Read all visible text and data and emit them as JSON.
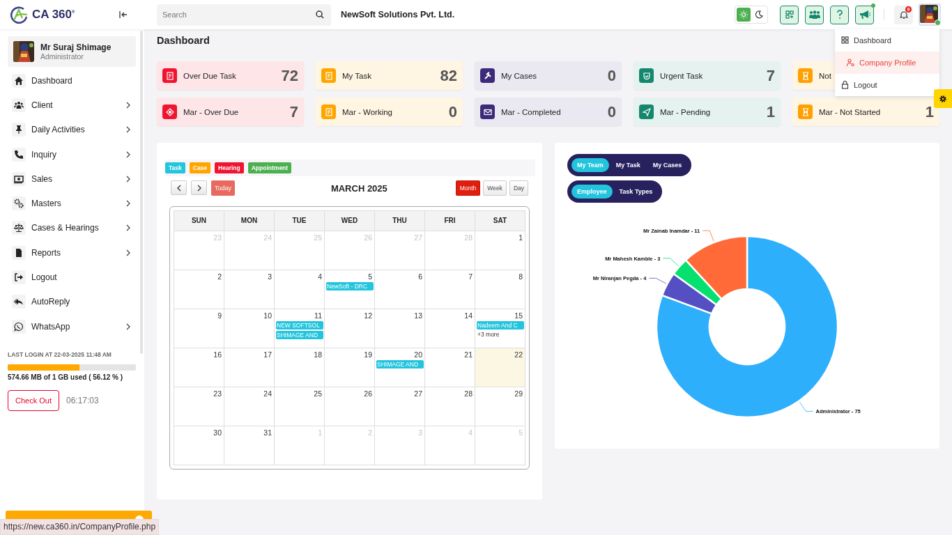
{
  "header": {
    "logo_text": "CA 360$^{®}$",
    "search": {
      "placeholder": "Search"
    },
    "company": "NewSoft Solutions Pvt. Ltd.",
    "theme": [
      {
        "kind": "sun",
        "selected": true
      },
      {
        "kind": "moon",
        "selected": false
      }
    ],
    "tools": [
      {
        "kind": "grid-plus",
        "dot": false
      },
      {
        "kind": "team",
        "dot": false
      },
      {
        "kind": "help",
        "dot": false
      },
      {
        "kind": "megaphone",
        "dot": true
      }
    ],
    "notifications": "9"
  },
  "user_menu": {
    "items": [
      {
        "kind": "grid",
        "label": "Dashboard",
        "selected": false
      },
      {
        "kind": "user-gear",
        "label": "Company Profile",
        "selected": true
      },
      {
        "kind": "lock",
        "label": "Logout",
        "selected": false
      }
    ]
  },
  "sidebar": {
    "profile": {
      "name": "Mr Suraj Shimage",
      "role": "Administrator"
    },
    "items": [
      {
        "kind": "home",
        "label": "Dashboard",
        "expandable": false
      },
      {
        "kind": "users",
        "label": "Client",
        "expandable": true
      },
      {
        "kind": "pin",
        "label": "Daily Activities",
        "expandable": true
      },
      {
        "kind": "phone",
        "label": "Inquiry",
        "expandable": true
      },
      {
        "kind": "money",
        "label": "Sales",
        "expandable": true
      },
      {
        "kind": "gears",
        "label": "Masters",
        "expandable": true
      },
      {
        "kind": "scales",
        "label": "Cases & Hearings",
        "expandable": true
      },
      {
        "kind": "file",
        "label": "Reports",
        "expandable": true
      },
      {
        "kind": "exit",
        "label": "Logout",
        "expandable": false
      },
      {
        "kind": "reply",
        "label": "AutoReply",
        "expandable": false
      },
      {
        "kind": "chat",
        "label": "WhatsApp",
        "expandable": true
      }
    ],
    "last_login": "LAST LOGIN AT 22-03-2025 11:48 AM",
    "storage": {
      "level": 0.5612,
      "text": "574.66 MB of 1 GB used ( 56.12 % )"
    },
    "check_out": "Check Out",
    "timer": "06:17:03"
  },
  "page_title": "Dashboard",
  "cards": [
    {
      "kind": "note",
      "label": "Over Due Task",
      "value": "72",
      "color": "#f0142f"
    },
    {
      "kind": "note",
      "label": "My Task",
      "value": "82",
      "color": "#ffa500"
    },
    {
      "kind": "gavel",
      "label": "My Cases",
      "value": "0",
      "color": "#3d2b7a"
    },
    {
      "kind": "shield",
      "label": "Urgent Task",
      "value": "7",
      "color": "#16876f"
    },
    {
      "kind": "hourglass",
      "label": "Not",
      "color": "#ffa000"
    },
    {
      "kind": "diamond",
      "label": "Mar - Over Due",
      "value": "7",
      "color": "#f0142f"
    },
    {
      "kind": "note",
      "label": "Mar - Working",
      "value": "0",
      "color": "#ffa500"
    },
    {
      "kind": "mail",
      "label": "Mar - Completed",
      "value": "0",
      "color": "#3d2b7a"
    },
    {
      "kind": "send",
      "label": "Mar - Pending",
      "value": "1",
      "color": "#16876f"
    },
    {
      "kind": "hourglass",
      "label": "Mar - Not Started",
      "value": "1",
      "color": "#ffa000"
    }
  ],
  "calendar": {
    "legend": [
      {
        "label": "Task",
        "color": "#22c5dd"
      },
      {
        "label": "Case",
        "color": "#ffa500"
      },
      {
        "label": "Hearing",
        "color": "#f0142f"
      },
      {
        "label": "Appointment",
        "color": "#4caf50"
      }
    ],
    "today_button": "Today",
    "title": "MARCH 2025",
    "views": [
      {
        "label": "Month",
        "selected": true
      },
      {
        "label": "Week",
        "selected": false
      },
      {
        "label": "Day",
        "selected": false
      }
    ],
    "weekdays": [
      "SUN",
      "MON",
      "TUE",
      "WED",
      "THU",
      "FRI",
      "SAT"
    ],
    "weeks": [
      [
        {
          "day": "23",
          "muted": true
        },
        {
          "day": "24",
          "muted": true
        },
        {
          "day": "25",
          "muted": true
        },
        {
          "day": "26",
          "muted": true
        },
        {
          "day": "27",
          "muted": true
        },
        {
          "day": "28",
          "muted": true
        },
        {
          "day": "1",
          "muted": false
        }
      ],
      [
        {
          "day": "2",
          "muted": false
        },
        {
          "day": "3",
          "muted": false
        },
        {
          "day": "4",
          "muted": false
        },
        {
          "day": "5",
          "muted": false,
          "events": [
            "NewSoft - DRC"
          ]
        },
        {
          "day": "6",
          "muted": false
        },
        {
          "day": "7",
          "muted": false
        },
        {
          "day": "8",
          "muted": false
        }
      ],
      [
        {
          "day": "9",
          "muted": false
        },
        {
          "day": "10",
          "muted": false
        },
        {
          "day": "11",
          "muted": false,
          "events": [
            "NEW SOFTSOL",
            "SHIMAGE AND"
          ]
        },
        {
          "day": "12",
          "muted": false
        },
        {
          "day": "13",
          "muted": false
        },
        {
          "day": "14",
          "muted": false
        },
        {
          "day": "15",
          "muted": false,
          "events": [
            "Nadeem And C"
          ],
          "more": "+3 more"
        }
      ],
      [
        {
          "day": "16",
          "muted": false
        },
        {
          "day": "17",
          "muted": false
        },
        {
          "day": "18",
          "muted": false
        },
        {
          "day": "19",
          "muted": false
        },
        {
          "day": "20",
          "muted": false,
          "events": [
            "SHIMAGE AND"
          ]
        },
        {
          "day": "21",
          "muted": false
        },
        {
          "day": "22",
          "muted": false,
          "today": true
        }
      ],
      [
        {
          "day": "23",
          "muted": false
        },
        {
          "day": "24",
          "muted": false
        },
        {
          "day": "25",
          "muted": false
        },
        {
          "day": "26",
          "muted": false
        },
        {
          "day": "27",
          "muted": false
        },
        {
          "day": "28",
          "muted": false
        },
        {
          "day": "29",
          "muted": false
        }
      ],
      [
        {
          "day": "30",
          "muted": false
        },
        {
          "day": "31",
          "muted": false
        },
        {
          "day": "1",
          "muted": true
        },
        {
          "day": "2",
          "muted": true
        },
        {
          "day": "3",
          "muted": true
        },
        {
          "day": "4",
          "muted": true
        },
        {
          "day": "5",
          "muted": true
        }
      ]
    ]
  },
  "team_panel": {
    "scope_tabs": [
      {
        "label": "My Team",
        "selected": true
      },
      {
        "label": "My Task",
        "selected": false
      },
      {
        "label": "My Cases",
        "selected": false
      }
    ],
    "group_tabs": [
      {
        "label": "Employee",
        "selected": true
      },
      {
        "label": "Task Types",
        "selected": false
      }
    ],
    "chart_data": {
      "type": "donut",
      "categories": [
        "Administrator - 75",
        "Mr Niranjan Pegda - 4",
        "Mr Mahesh Kamble - 3",
        "Mr Zainab Inamdar - 11"
      ],
      "series": [
        {
          "values": [
            80.64,
            4.3,
            3.23,
            11.83
          ]
        }
      ],
      "colors": [
        "#2eaffc",
        "#5450c4",
        "#06e06e",
        "#ff6a38"
      ]
    }
  },
  "status_url": "https://new.ca360.in/CompanyProfile.php"
}
